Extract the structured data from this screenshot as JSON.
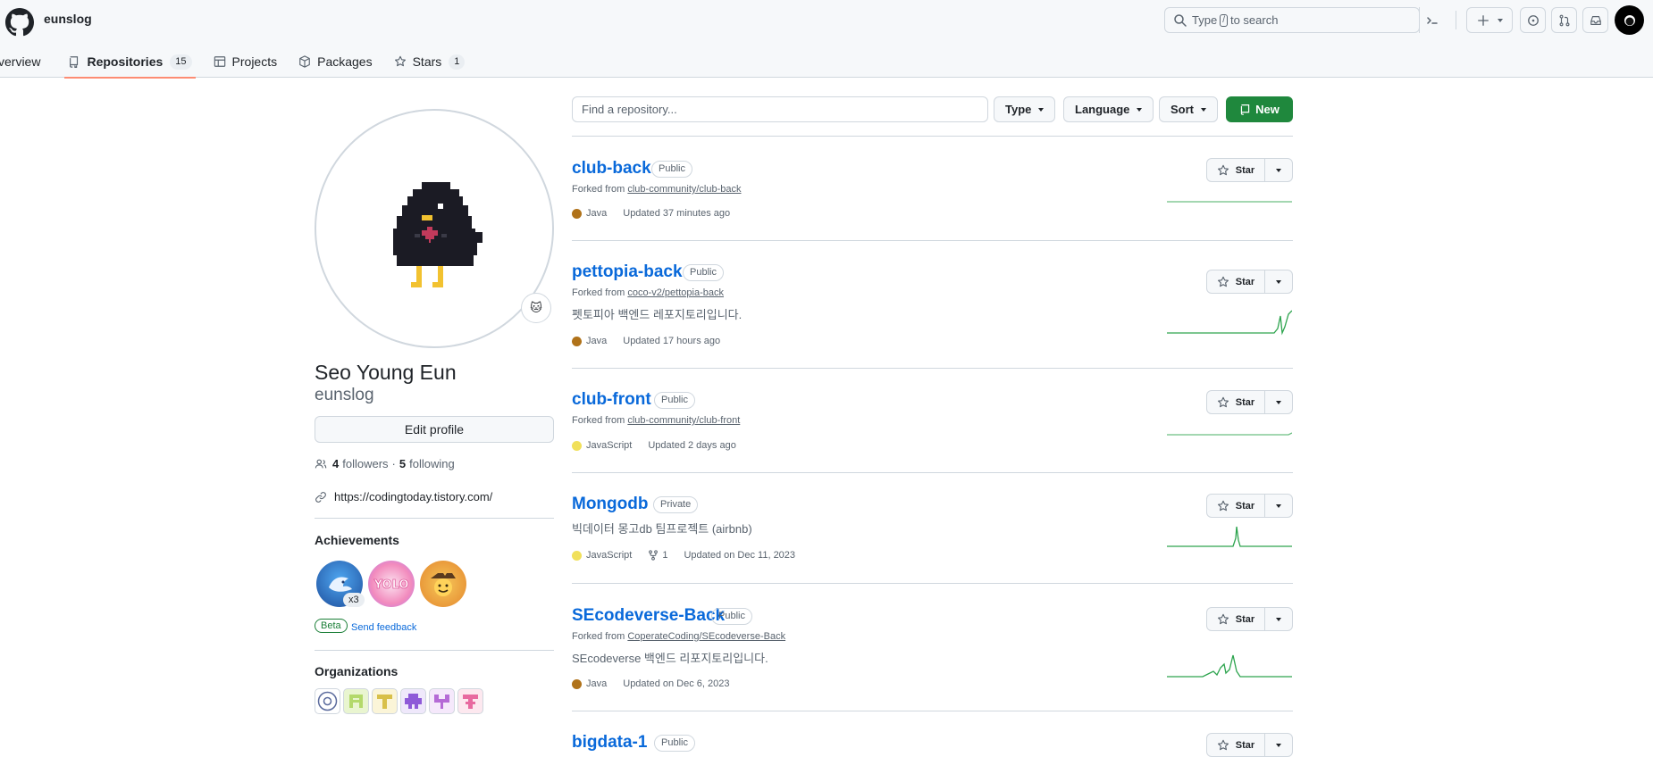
{
  "header": {
    "username": "eunslog",
    "search": {
      "prefix": "Type",
      "key": "/",
      "suffix": "to search"
    }
  },
  "tabs": [
    {
      "label": "Overview",
      "shown": "verview",
      "icon": "book-icon"
    },
    {
      "label": "Repositories",
      "count": "15",
      "icon": "repo-icon",
      "active": true
    },
    {
      "label": "Projects",
      "icon": "table-icon"
    },
    {
      "label": "Packages",
      "icon": "package-icon"
    },
    {
      "label": "Stars",
      "count": "1",
      "icon": "star-icon"
    }
  ],
  "profile": {
    "status_emoji": "🐱",
    "full_name": "Seo Young Eun",
    "login": "eunslog",
    "edit_label": "Edit profile",
    "followers": "4",
    "followers_label": "followers",
    "separator": "·",
    "following": "5",
    "following_label": "following",
    "website": "https://codingtoday.tistory.com/",
    "achievements_title": "Achievements",
    "achievement_count": "x3",
    "beta_label": "Beta",
    "feedback_label": "Send feedback",
    "organizations_title": "Organizations"
  },
  "filters": {
    "search_placeholder": "Find a repository...",
    "type_label": "Type",
    "language_label": "Language",
    "sort_label": "Sort",
    "new_label": "New"
  },
  "repositories": [
    {
      "name": "club-back",
      "visibility": "Public",
      "forked_prefix": "Forked from",
      "forked_from": "club-community/club-back",
      "description": "",
      "language": "Java",
      "language_color": "#b07219",
      "forks": "",
      "updated": "Updated 37 minutes ago",
      "star_label": "Star"
    },
    {
      "name": "pettopia-back",
      "visibility": "Public",
      "forked_prefix": "Forked from",
      "forked_from": "coco-v2/pettopia-back",
      "description": "펫토피아 백엔드 레포지토리입니다.",
      "language": "Java",
      "language_color": "#b07219",
      "forks": "",
      "updated": "Updated 17 hours ago",
      "star_label": "Star"
    },
    {
      "name": "club-front",
      "visibility": "Public",
      "forked_prefix": "Forked from",
      "forked_from": "club-community/club-front",
      "description": "",
      "language": "JavaScript",
      "language_color": "#f1e05a",
      "forks": "",
      "updated": "Updated 2 days ago",
      "star_label": "Star"
    },
    {
      "name": "Mongodb",
      "visibility": "Private",
      "forked_prefix": "",
      "forked_from": "",
      "description": "빅데이터 몽고db 팀프로젝트 (airbnb)",
      "language": "JavaScript",
      "language_color": "#f1e05a",
      "forks": "1",
      "updated": "Updated on Dec 11, 2023",
      "star_label": "Star"
    },
    {
      "name": "SEcodeverse-Back",
      "visibility": "Public",
      "forked_prefix": "Forked from",
      "forked_from": "CoperateCoding/SEcodeverse-Back",
      "description": "SEcodeverse 백엔드 리포지토리입니다.",
      "language": "Java",
      "language_color": "#b07219",
      "forks": "",
      "updated": "Updated on Dec 6, 2023",
      "star_label": "Star"
    },
    {
      "name": "bigdata-1",
      "visibility": "Public",
      "star_label": "Star"
    }
  ],
  "colors": {
    "accent": "#0969da",
    "new_button": "#1f883d",
    "tab_underline": "#fd8c73",
    "spark": "#2da44e"
  }
}
